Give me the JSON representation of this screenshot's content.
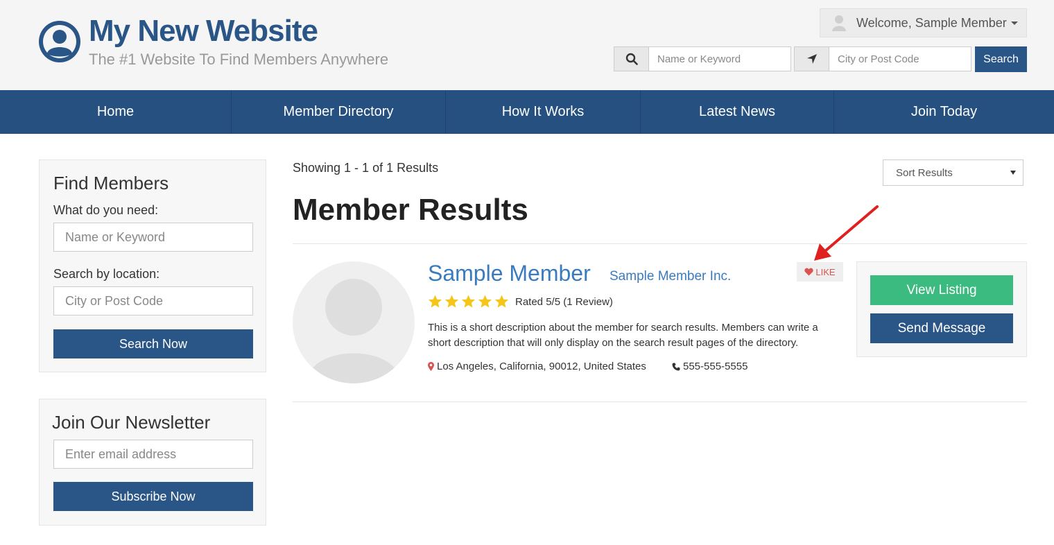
{
  "header": {
    "site_title": "My New Website",
    "tagline": "The #1 Website To Find Members Anywhere",
    "welcome_text": "Welcome, Sample Member",
    "keyword_placeholder": "Name or Keyword",
    "location_placeholder": "City or Post Code",
    "search_label": "Search",
    "brand_color": "#2a5587"
  },
  "nav": {
    "items": [
      {
        "label": "Home"
      },
      {
        "label": "Member Directory"
      },
      {
        "label": "How It Works"
      },
      {
        "label": "Latest News"
      },
      {
        "label": "Join Today"
      }
    ]
  },
  "sidebar": {
    "find": {
      "title": "Find Members",
      "keyword_label": "What do you need:",
      "keyword_placeholder": "Name or Keyword",
      "location_label": "Search by location:",
      "location_placeholder": "City or Post Code",
      "button_label": "Search Now"
    },
    "newsletter": {
      "title": "Join Our Newsletter",
      "email_placeholder": "Enter email address",
      "button_label": "Subscribe Now"
    }
  },
  "main": {
    "showing_text": "Showing 1 - 1 of 1 Results",
    "sort_label": "Sort Results",
    "heading": "Member Results",
    "results": [
      {
        "name": "Sample Member",
        "company": "Sample Member Inc.",
        "like_label": "LIKE",
        "rating_stars": 5,
        "rating_text": "Rated 5/5 (1 Review)",
        "description": "This is a short description about the member for search results. Members can write a short description that will only display on the search result pages of the directory.",
        "location": "Los Angeles, California, 90012, United States",
        "phone": "555-555-5555",
        "view_listing_label": "View Listing",
        "send_message_label": "Send Message"
      }
    ]
  },
  "colors": {
    "nav_bg": "#25507f",
    "accent_green": "#3bbb7f",
    "link_blue": "#3a7bbf",
    "star_yellow": "#f5c518",
    "like_red": "#d9534f",
    "arrow_red": "#e0201f"
  }
}
